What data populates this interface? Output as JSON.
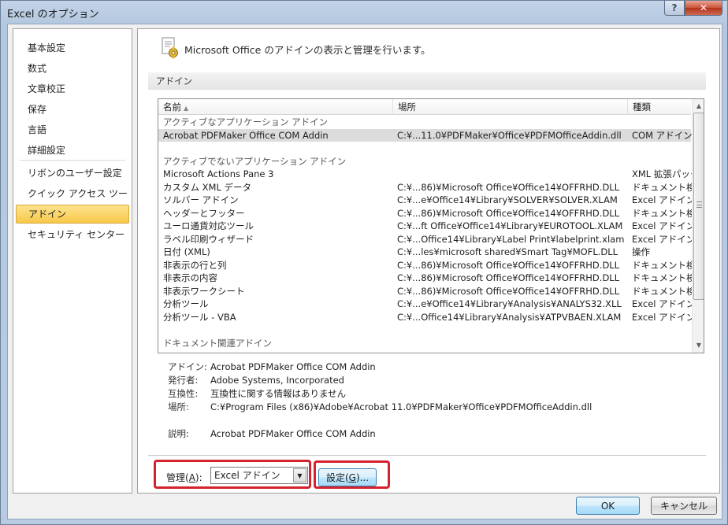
{
  "window": {
    "title": "Excel のオプション",
    "help_label": "?",
    "close_label": "✕"
  },
  "nav": {
    "items": [
      {
        "label": "基本設定"
      },
      {
        "label": "数式"
      },
      {
        "label": "文章校正"
      },
      {
        "label": "保存"
      },
      {
        "label": "言語"
      },
      {
        "label": "詳細設定"
      },
      {
        "label": "リボンのユーザー設定"
      },
      {
        "label": "クイック アクセス ツール バー"
      },
      {
        "label": "アドイン"
      },
      {
        "label": "セキュリティ センター"
      }
    ],
    "active_index": 8
  },
  "main": {
    "header_text": "Microsoft Office のアドインの表示と管理を行います。",
    "section_title": "アドイン",
    "columns": {
      "name": "名前",
      "name_sort": "▲",
      "location": "場所",
      "type": "種類"
    },
    "rows": [
      {
        "kind": "group",
        "name": "アクティブなアプリケーション アドイン",
        "location": "",
        "type": ""
      },
      {
        "kind": "item",
        "selected": true,
        "name": "Acrobat PDFMaker Office COM Addin",
        "location": "C:¥...11.0¥PDFMaker¥Office¥PDFMOfficeAddin.dll",
        "type": "COM アドイン"
      },
      {
        "kind": "blank",
        "name": "",
        "location": "",
        "type": ""
      },
      {
        "kind": "group",
        "name": "アクティブでないアプリケーション アドイン",
        "location": "",
        "type": ""
      },
      {
        "kind": "item",
        "name": "Microsoft Actions Pane 3",
        "location": "",
        "type": "XML 拡張パック"
      },
      {
        "kind": "item",
        "name": "カスタム XML データ",
        "location": "C:¥...86)¥Microsoft Office¥Office14¥OFFRHD.DLL",
        "type": "ドキュメント検査"
      },
      {
        "kind": "item",
        "name": "ソルバー アドイン",
        "location": "C:¥...e¥Office14¥Library¥SOLVER¥SOLVER.XLAM",
        "type": "Excel アドイン"
      },
      {
        "kind": "item",
        "name": "ヘッダーとフッター",
        "location": "C:¥...86)¥Microsoft Office¥Office14¥OFFRHD.DLL",
        "type": "ドキュメント検査"
      },
      {
        "kind": "item",
        "name": "ユーロ通貨対応ツール",
        "location": "C:¥...ft Office¥Office14¥Library¥EUROTOOL.XLAM",
        "type": "Excel アドイン"
      },
      {
        "kind": "item",
        "name": "ラベル印刷ウィザード",
        "location": "C:¥...Office14¥Library¥Label Print¥labelprint.xlam",
        "type": "Excel アドイン"
      },
      {
        "kind": "item",
        "name": "日付 (XML)",
        "location": "C:¥...les¥microsoft shared¥Smart Tag¥MOFL.DLL",
        "type": "操作"
      },
      {
        "kind": "item",
        "name": "非表示の行と列",
        "location": "C:¥...86)¥Microsoft Office¥Office14¥OFFRHD.DLL",
        "type": "ドキュメント検査"
      },
      {
        "kind": "item",
        "name": "非表示の内容",
        "location": "C:¥...86)¥Microsoft Office¥Office14¥OFFRHD.DLL",
        "type": "ドキュメント検査"
      },
      {
        "kind": "item",
        "name": "非表示ワークシート",
        "location": "C:¥...86)¥Microsoft Office¥Office14¥OFFRHD.DLL",
        "type": "ドキュメント検査"
      },
      {
        "kind": "item",
        "name": "分析ツール",
        "location": "C:¥...e¥Office14¥Library¥Analysis¥ANALYS32.XLL",
        "type": "Excel アドイン"
      },
      {
        "kind": "item",
        "name": "分析ツール - VBA",
        "location": "C:¥...Office14¥Library¥Analysis¥ATPVBAEN.XLAM",
        "type": "Excel アドイン"
      },
      {
        "kind": "blank",
        "name": "",
        "location": "",
        "type": ""
      },
      {
        "kind": "group",
        "name": "ドキュメント関連アドイン",
        "location": "",
        "type": ""
      }
    ],
    "details": [
      {
        "label": "アドイン:",
        "value": "Acrobat PDFMaker Office COM Addin"
      },
      {
        "label": "発行者:",
        "value": "Adobe Systems, Incorporated"
      },
      {
        "label": "互換性:",
        "value": "互換性に関する情報はありません"
      },
      {
        "label": "場所:",
        "value": "C:¥Program Files (x86)¥Adobe¥Acrobat 11.0¥PDFMaker¥Office¥PDFMOfficeAddin.dll"
      },
      {
        "label": "",
        "value": ""
      },
      {
        "label": "説明:",
        "value": "Acrobat PDFMaker Office COM Addin"
      }
    ],
    "manage": {
      "label_prefix": "管理(",
      "label_accel": "A",
      "label_suffix": "):",
      "selected": "Excel アドイン",
      "settings_prefix": "設定(",
      "settings_accel": "G",
      "settings_suffix": ")..."
    }
  },
  "footer": {
    "ok_label": "OK",
    "cancel_label": "キャンセル"
  },
  "highlight_color": "#d6212e"
}
